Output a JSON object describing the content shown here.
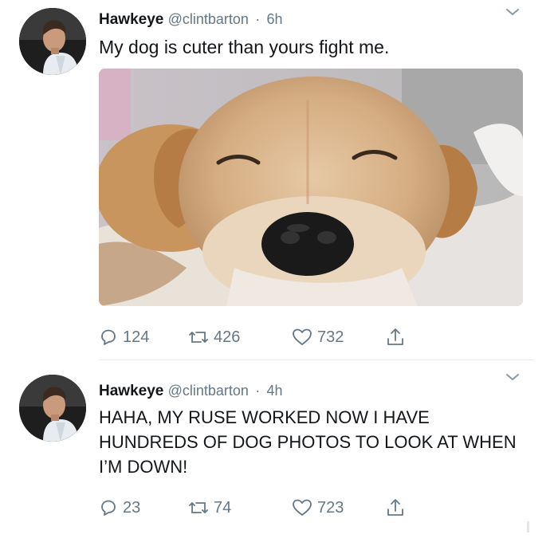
{
  "tweets": [
    {
      "name": "Hawkeye",
      "handle": "@clintbarton",
      "time": "6h",
      "text": "My dog is cuter than yours fight me.",
      "media": "golden-retriever-photo",
      "replies": "124",
      "retweets": "426",
      "likes": "732"
    },
    {
      "name": "Hawkeye",
      "handle": "@clintbarton",
      "time": "4h",
      "text": "HAHA, MY RUSE WORKED NOW I HAVE HUNDREDS OF DOG PHOTOS TO LOOK AT WHEN I’M DOWN!",
      "replies": "23",
      "retweets": "74",
      "likes": "723"
    }
  ],
  "separator": "·",
  "icons": {
    "reply": "reply-icon",
    "retweet": "retweet-icon",
    "like": "heart-icon",
    "share": "share-icon",
    "menu": "chevron-down-icon"
  },
  "colors": {
    "text": "#14171a",
    "secondary": "#657786",
    "divider": "#e6ecf0"
  }
}
